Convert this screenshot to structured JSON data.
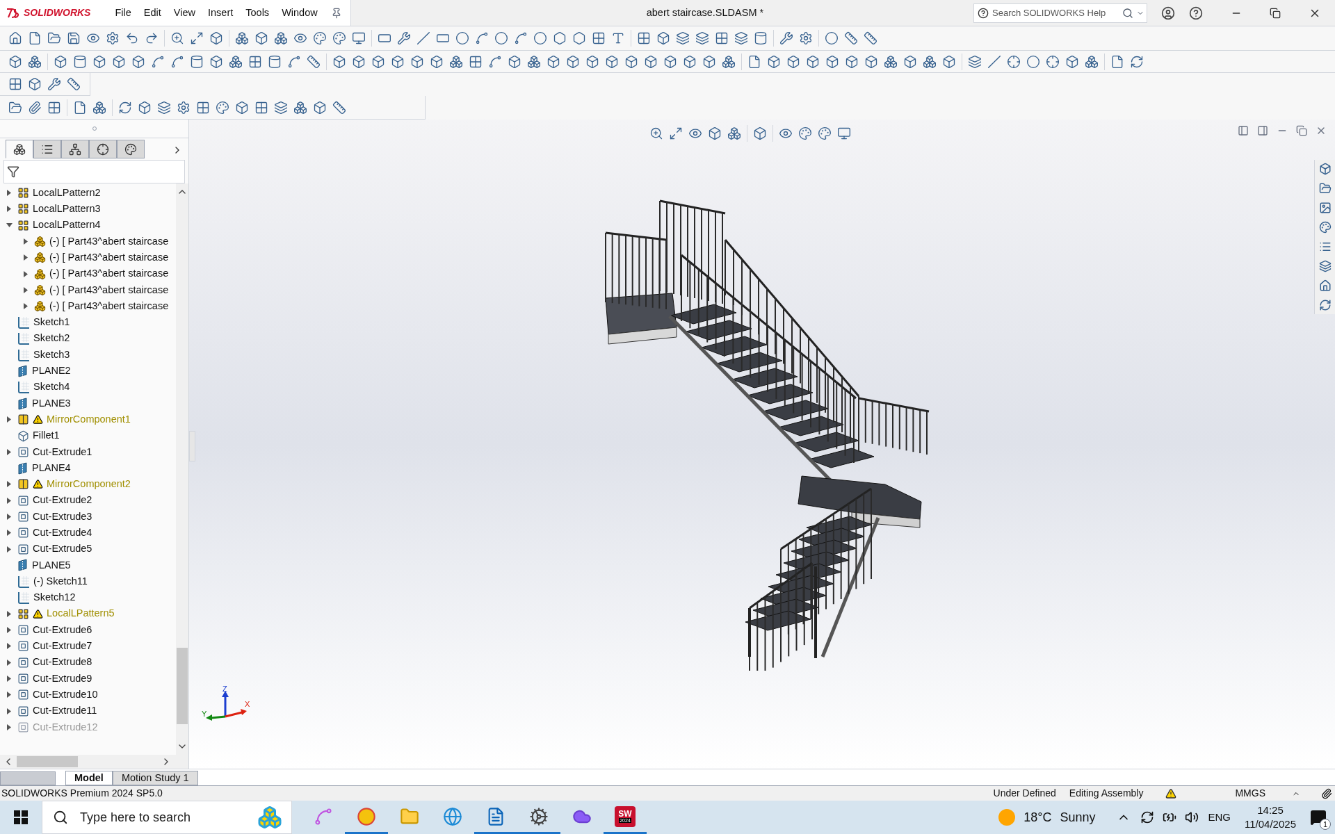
{
  "app": {
    "logo": "SOLIDWORKS",
    "menu": [
      "File",
      "Edit",
      "View",
      "Insert",
      "Tools",
      "Window"
    ],
    "title": "abert staircase.SLDASM *",
    "search": {
      "placeholder": "Search SOLIDWORKS Help"
    }
  },
  "feature_tabs": [
    {
      "kind": "features",
      "selected": true
    },
    {
      "kind": "properties",
      "selected": false
    },
    {
      "kind": "configurations",
      "selected": false
    },
    {
      "kind": "dimxpert",
      "selected": false
    },
    {
      "kind": "display",
      "selected": false
    }
  ],
  "tree": [
    {
      "label": "LocalLPattern2",
      "kind": "pattern",
      "expandable": true,
      "expanded": false,
      "warning": false,
      "suppressed": false
    },
    {
      "label": "LocalLPattern3",
      "kind": "pattern",
      "expandable": true,
      "expanded": false,
      "warning": false,
      "suppressed": false
    },
    {
      "label": "LocalLPattern4",
      "kind": "pattern",
      "expandable": true,
      "expanded": true,
      "warning": false,
      "suppressed": false,
      "children": [
        {
          "label": "(-) [ Part43^abert staircase",
          "kind": "part",
          "expandable": true,
          "expanded": false,
          "warning": false,
          "suppressed": false
        },
        {
          "label": "(-) [ Part43^abert staircase",
          "kind": "part",
          "expandable": true,
          "expanded": false,
          "warning": false,
          "suppressed": false
        },
        {
          "label": "(-) [ Part43^abert staircase",
          "kind": "part",
          "expandable": true,
          "expanded": false,
          "warning": false,
          "suppressed": false
        },
        {
          "label": "(-) [ Part43^abert staircase",
          "kind": "part",
          "expandable": true,
          "expanded": false,
          "warning": false,
          "suppressed": false
        },
        {
          "label": "(-) [ Part43^abert staircase",
          "kind": "part",
          "expandable": true,
          "expanded": false,
          "warning": false,
          "suppressed": false
        }
      ]
    },
    {
      "label": "Sketch1",
      "kind": "sketch",
      "expandable": false,
      "expanded": false,
      "warning": false,
      "suppressed": false
    },
    {
      "label": "Sketch2",
      "kind": "sketch",
      "expandable": false,
      "expanded": false,
      "warning": false,
      "suppressed": false
    },
    {
      "label": "Sketch3",
      "kind": "sketch",
      "expandable": false,
      "expanded": false,
      "warning": false,
      "suppressed": false
    },
    {
      "label": "PLANE2",
      "kind": "plane",
      "expandable": false,
      "expanded": false,
      "warning": false,
      "suppressed": false
    },
    {
      "label": "Sketch4",
      "kind": "sketch",
      "expandable": false,
      "expanded": false,
      "warning": false,
      "suppressed": false
    },
    {
      "label": "PLANE3",
      "kind": "plane",
      "expandable": false,
      "expanded": false,
      "warning": false,
      "suppressed": false
    },
    {
      "label": "MirrorComponent1",
      "kind": "mirror",
      "expandable": true,
      "expanded": false,
      "warning": true,
      "suppressed": false
    },
    {
      "label": "Fillet1",
      "kind": "fillet",
      "expandable": false,
      "expanded": false,
      "warning": false,
      "suppressed": false
    },
    {
      "label": "Cut-Extrude1",
      "kind": "cut",
      "expandable": true,
      "expanded": false,
      "warning": false,
      "suppressed": false
    },
    {
      "label": "PLANE4",
      "kind": "plane",
      "expandable": false,
      "expanded": false,
      "warning": false,
      "suppressed": false
    },
    {
      "label": "MirrorComponent2",
      "kind": "mirror",
      "expandable": true,
      "expanded": false,
      "warning": true,
      "suppressed": false
    },
    {
      "label": "Cut-Extrude2",
      "kind": "cut",
      "expandable": true,
      "expanded": false,
      "warning": false,
      "suppressed": false
    },
    {
      "label": "Cut-Extrude3",
      "kind": "cut",
      "expandable": true,
      "expanded": false,
      "warning": false,
      "suppressed": false
    },
    {
      "label": "Cut-Extrude4",
      "kind": "cut",
      "expandable": true,
      "expanded": false,
      "warning": false,
      "suppressed": false
    },
    {
      "label": "Cut-Extrude5",
      "kind": "cut",
      "expandable": true,
      "expanded": false,
      "warning": false,
      "suppressed": false
    },
    {
      "label": "PLANE5",
      "kind": "plane",
      "expandable": false,
      "expanded": false,
      "warning": false,
      "suppressed": false
    },
    {
      "label": "(-) Sketch11",
      "kind": "sketch",
      "expandable": false,
      "expanded": false,
      "warning": false,
      "suppressed": false
    },
    {
      "label": "Sketch12",
      "kind": "sketch",
      "expandable": false,
      "expanded": false,
      "warning": false,
      "suppressed": false
    },
    {
      "label": "LocalLPattern5",
      "kind": "pattern",
      "expandable": true,
      "expanded": false,
      "warning": true,
      "suppressed": false
    },
    {
      "label": "Cut-Extrude6",
      "kind": "cut",
      "expandable": true,
      "expanded": false,
      "warning": false,
      "suppressed": false
    },
    {
      "label": "Cut-Extrude7",
      "kind": "cut",
      "expandable": true,
      "expanded": false,
      "warning": false,
      "suppressed": false
    },
    {
      "label": "Cut-Extrude8",
      "kind": "cut",
      "expandable": true,
      "expanded": false,
      "warning": false,
      "suppressed": false
    },
    {
      "label": "Cut-Extrude9",
      "kind": "cut",
      "expandable": true,
      "expanded": false,
      "warning": false,
      "suppressed": false
    },
    {
      "label": "Cut-Extrude10",
      "kind": "cut",
      "expandable": true,
      "expanded": false,
      "warning": false,
      "suppressed": false
    },
    {
      "label": "Cut-Extrude11",
      "kind": "cut",
      "expandable": true,
      "expanded": false,
      "warning": false,
      "suppressed": false
    },
    {
      "label": "Cut-Extrude12",
      "kind": "cut",
      "expandable": true,
      "expanded": false,
      "warning": false,
      "suppressed": true
    }
  ],
  "triad": {
    "x": "X",
    "y": "Y",
    "z": "Z"
  },
  "bottom_tabs": [
    {
      "label": "Model",
      "selected": true
    },
    {
      "label": "Motion Study 1",
      "selected": false
    }
  ],
  "status_bar": {
    "product": "SOLIDWORKS Premium 2024 SP5.0",
    "items": [
      "Under Defined",
      "Editing Assembly"
    ],
    "units": "MMGS"
  },
  "taskbar": {
    "search_placeholder": "Type here to search",
    "apps": [
      {
        "kind": "copilot",
        "open": false
      },
      {
        "kind": "chrome",
        "open": true
      },
      {
        "kind": "files",
        "open": false
      },
      {
        "kind": "edge",
        "open": false
      },
      {
        "kind": "outlook",
        "open": true
      },
      {
        "kind": "settings",
        "open": true
      },
      {
        "kind": "cloud",
        "open": false
      },
      {
        "kind": "solidworks",
        "open": true,
        "label": "SW",
        "badge": "2024"
      }
    ],
    "temperature": "18°C",
    "weather": "Sunny",
    "language": "ENG",
    "time": "14:25",
    "date": "11/04/2025",
    "notifications": "1"
  }
}
